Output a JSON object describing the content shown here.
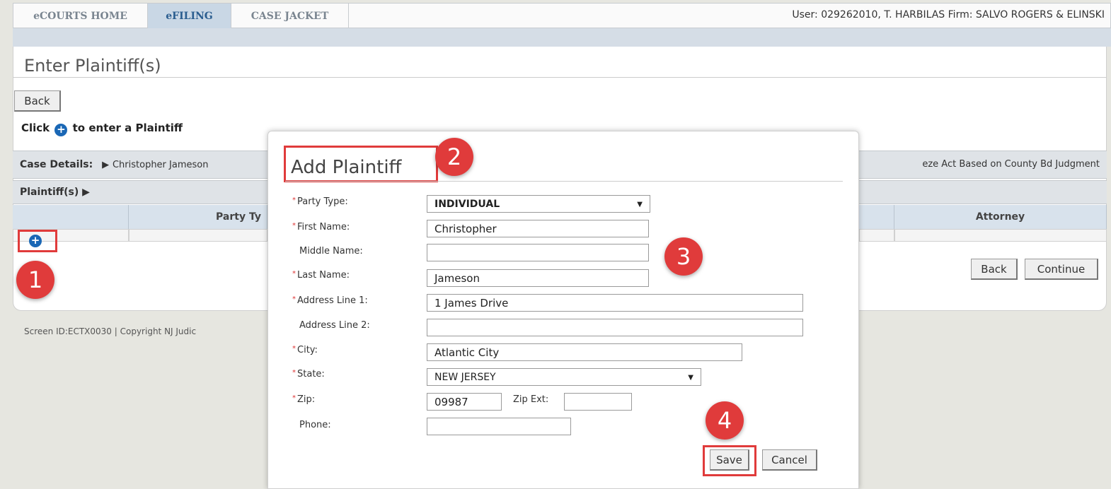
{
  "nav": {
    "tabs": [
      "eCOURTS HOME",
      "eFILING",
      "CASE JACKET"
    ],
    "user_info": "User: 029262010, T. HARBILAS  Firm: SALVO ROGERS & ELINSKI"
  },
  "page": {
    "title": "Enter Plaintiff(s)",
    "back_label": "Back",
    "click_prefix": "Click",
    "click_suffix": "to enter a Plaintiff",
    "case_details_label": "Case Details:",
    "case_details_name": "Christopher Jameson",
    "case_details_right": "eze Act  Based on County Bd Judgment",
    "plaintiffs_label": "Plaintiff(s) ▶",
    "columns": [
      "Party Ty",
      "Attorney"
    ],
    "back2_label": "Back",
    "continue_label": "Continue",
    "footer": "Screen ID:ECTX0030   |   Copyright NJ Judic"
  },
  "modal": {
    "title": "Add Plaintiff",
    "fields": {
      "party_type": {
        "label": "Party Type:",
        "value": "INDIVIDUAL"
      },
      "first_name": {
        "label": "First Name:",
        "value": "Christopher"
      },
      "middle_name": {
        "label": "Middle Name:",
        "value": ""
      },
      "last_name": {
        "label": "Last Name:",
        "value": "Jameson"
      },
      "address1": {
        "label": "Address Line 1:",
        "value": "1 James Drive"
      },
      "address2": {
        "label": "Address Line 2:",
        "value": ""
      },
      "city": {
        "label": "City:",
        "value": "Atlantic City"
      },
      "state": {
        "label": "State:",
        "value": "NEW JERSEY"
      },
      "zip": {
        "label": "Zip:",
        "value": "09987"
      },
      "zip_ext": {
        "label": "Zip Ext:",
        "value": ""
      },
      "phone": {
        "label": "Phone:",
        "value": ""
      }
    },
    "save_label": "Save",
    "cancel_label": "Cancel"
  },
  "callouts": [
    "1",
    "2",
    "3",
    "4"
  ],
  "colors": {
    "callout": "#e03b3b",
    "active_tab": "#c9d7e5",
    "plus_icon": "#1a67b5"
  }
}
